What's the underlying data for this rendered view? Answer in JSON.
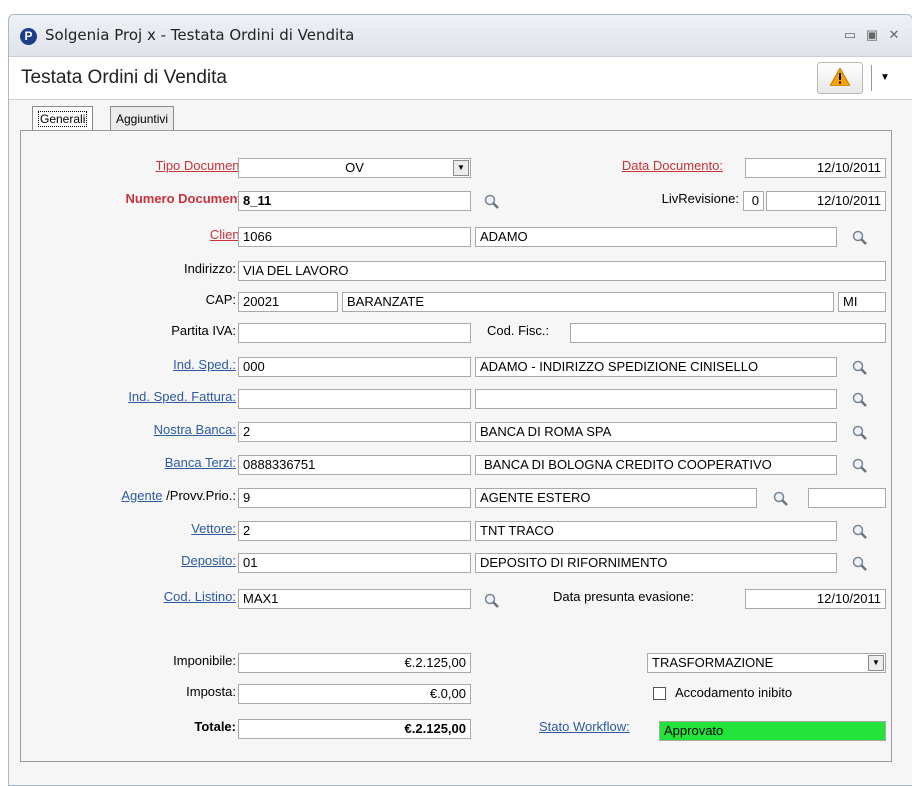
{
  "window": {
    "title": "Solgenia Proj x - Testata Ordini di Vendita",
    "icon_letter": "P"
  },
  "header": {
    "title": "Testata Ordini di Vendita",
    "warning_icon": "warning-icon",
    "dropdown_glyph": "▼"
  },
  "tabs": [
    {
      "label": "Generali"
    },
    {
      "label": "Aggiuntivi"
    }
  ],
  "form": {
    "tipo_documento": {
      "label": "Tipo Documento:",
      "value": "OV"
    },
    "data_documento": {
      "label": "Data Documento:",
      "value": "12/10/2011"
    },
    "numero_documento": {
      "label": "Numero Documento:",
      "value": "8_11"
    },
    "liv_revisione": {
      "label": "LivRevisione:",
      "value": "0",
      "date": "12/10/2011"
    },
    "cliente": {
      "label": "Cliente:",
      "code": "1066",
      "name": "ADAMO"
    },
    "indirizzo": {
      "label": "Indirizzo:",
      "value": "VIA DEL LAVORO"
    },
    "cap": {
      "label": "CAP:",
      "value": "20021",
      "city": "BARANZATE",
      "prov": "MI"
    },
    "partita_iva": {
      "label": "Partita IVA:",
      "value": ""
    },
    "cod_fisc": {
      "label": "Cod. Fisc.:",
      "value": ""
    },
    "ind_sped": {
      "label": "Ind. Sped.:",
      "code": "000",
      "desc": "ADAMO - INDIRIZZO SPEDIZIONE  CINISELLO"
    },
    "ind_sped_fattura": {
      "label": "Ind. Sped. Fattura:",
      "code": "",
      "desc": ""
    },
    "nostra_banca": {
      "label": "Nostra Banca:",
      "code": "2",
      "desc": "BANCA DI ROMA SPA"
    },
    "banca_terzi": {
      "label": "Banca Terzi:",
      "code": "0888336751",
      "desc": "BANCA DI BOLOGNA  CREDITO COOPERATIVO"
    },
    "agente": {
      "label": "Agente",
      "label2": "/Provv.Prio.:",
      "code": "9",
      "desc": "AGENTE ESTERO",
      "provv": ""
    },
    "vettore": {
      "label": "Vettore:",
      "code": "2",
      "desc": "TNT TRACO"
    },
    "deposito": {
      "label": "Deposito:",
      "code": "01",
      "desc": "DEPOSITO DI RIFORNIMENTO"
    },
    "cod_listino": {
      "label": "Cod. Listino:",
      "value": "MAX1"
    },
    "data_presunta": {
      "label": "Data presunta evasione:",
      "value": "12/10/2011"
    }
  },
  "totals": {
    "imponibile": {
      "label": "Imponibile:",
      "value": "€.2.125,00"
    },
    "imposta": {
      "label": "Imposta:",
      "value": "€.0,00"
    },
    "totale": {
      "label": "Totale:",
      "value": "€.2.125,00"
    }
  },
  "workflow": {
    "state_select": "TRASFORMAZIONE",
    "accodamento_label": "Accodamento inibito",
    "stato_label": "Stato Workflow:",
    "stato_value": "Approvato",
    "stato_color": "#22e33a"
  }
}
